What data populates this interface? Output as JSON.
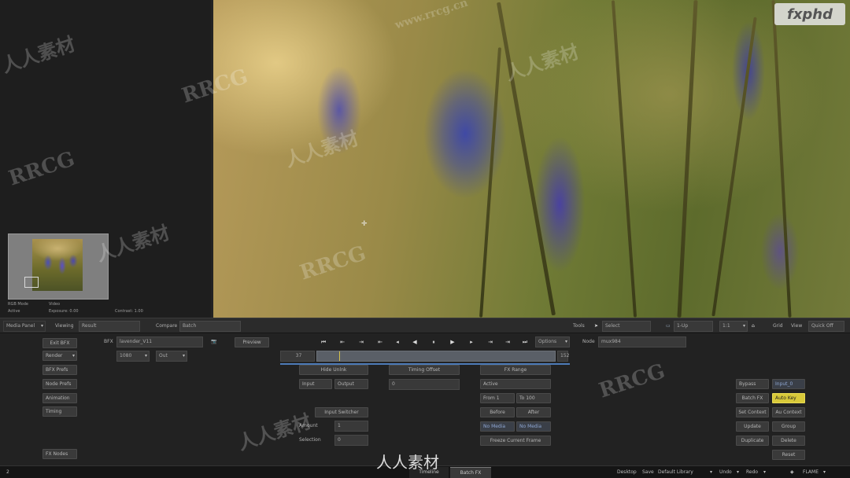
{
  "viewer": {
    "logo": "fxphd",
    "thumb_info": [
      "RGB Mode",
      "Video",
      "Active",
      "Exposure: 0.00",
      "Contrast: 1.00"
    ]
  },
  "topbar": {
    "media_panel": "Media Panel",
    "viewing_label": "Viewing",
    "viewing_value": "Result",
    "compare_label": "Compare",
    "compare_value": "Batch",
    "tools_label": "Tools",
    "select_value": "Select",
    "layout_value": "1-Up",
    "zoom_value": "1:1",
    "grid_label": "Grid",
    "view_label": "View",
    "quick_off": "Quick Off"
  },
  "left_buttons": [
    "Exit BFX",
    "Render",
    "BFX Prefs",
    "Node Prefs",
    "Animation",
    "Timing",
    "FX Nodes"
  ],
  "bfx": {
    "label": "BFX",
    "name": "lavender_V11",
    "preview": "Preview",
    "sub1": "1080",
    "sub2": "Out"
  },
  "transport": {
    "options": "Options",
    "node_label": "Node",
    "node_value": "mux984",
    "frame_start": "37",
    "frame_end": "152"
  },
  "middle": {
    "hide_unlink": "Hide Unlnk",
    "input": "Input",
    "output": "Output",
    "timing_offset": "Timing Offset",
    "offset_value": "0",
    "input_switcher": "Input Switcher",
    "amount_label": "Amount",
    "amount_value": "1",
    "selection_label": "Selection",
    "selection_value": "0"
  },
  "fx": {
    "fx_range": "FX Range",
    "active": "Active",
    "from": "From 1",
    "to": "To 100",
    "before": "Before",
    "after": "After",
    "no_media_1": "No Media",
    "no_media_2": "No Media",
    "freeze": "Freeze Current Frame"
  },
  "right_buttons": {
    "bypass": "Bypass",
    "input_0": "Input_0",
    "batch_fx": "Batch FX",
    "auto_key": "Auto Key",
    "set_context": "Set Context",
    "au_context": "Au Context",
    "update": "Update",
    "group": "Group",
    "duplicate": "Duplicate",
    "delete": "Delete",
    "reset": "Reset"
  },
  "bottombar": {
    "left_num": "2",
    "tab_timeline": "Timeline",
    "tab_batchfx": "Batch FX",
    "desktop": "Desktop",
    "save": "Save",
    "library": "Default Library",
    "undo": "Undo",
    "redo": "Redo",
    "flame": "FLAME"
  },
  "watermarks": [
    "RRCG",
    "人人素材",
    "www.rrcg.cn"
  ],
  "colors": {
    "accent_yellow": "#d8c93a",
    "panel": "#222222",
    "field": "#393939"
  }
}
